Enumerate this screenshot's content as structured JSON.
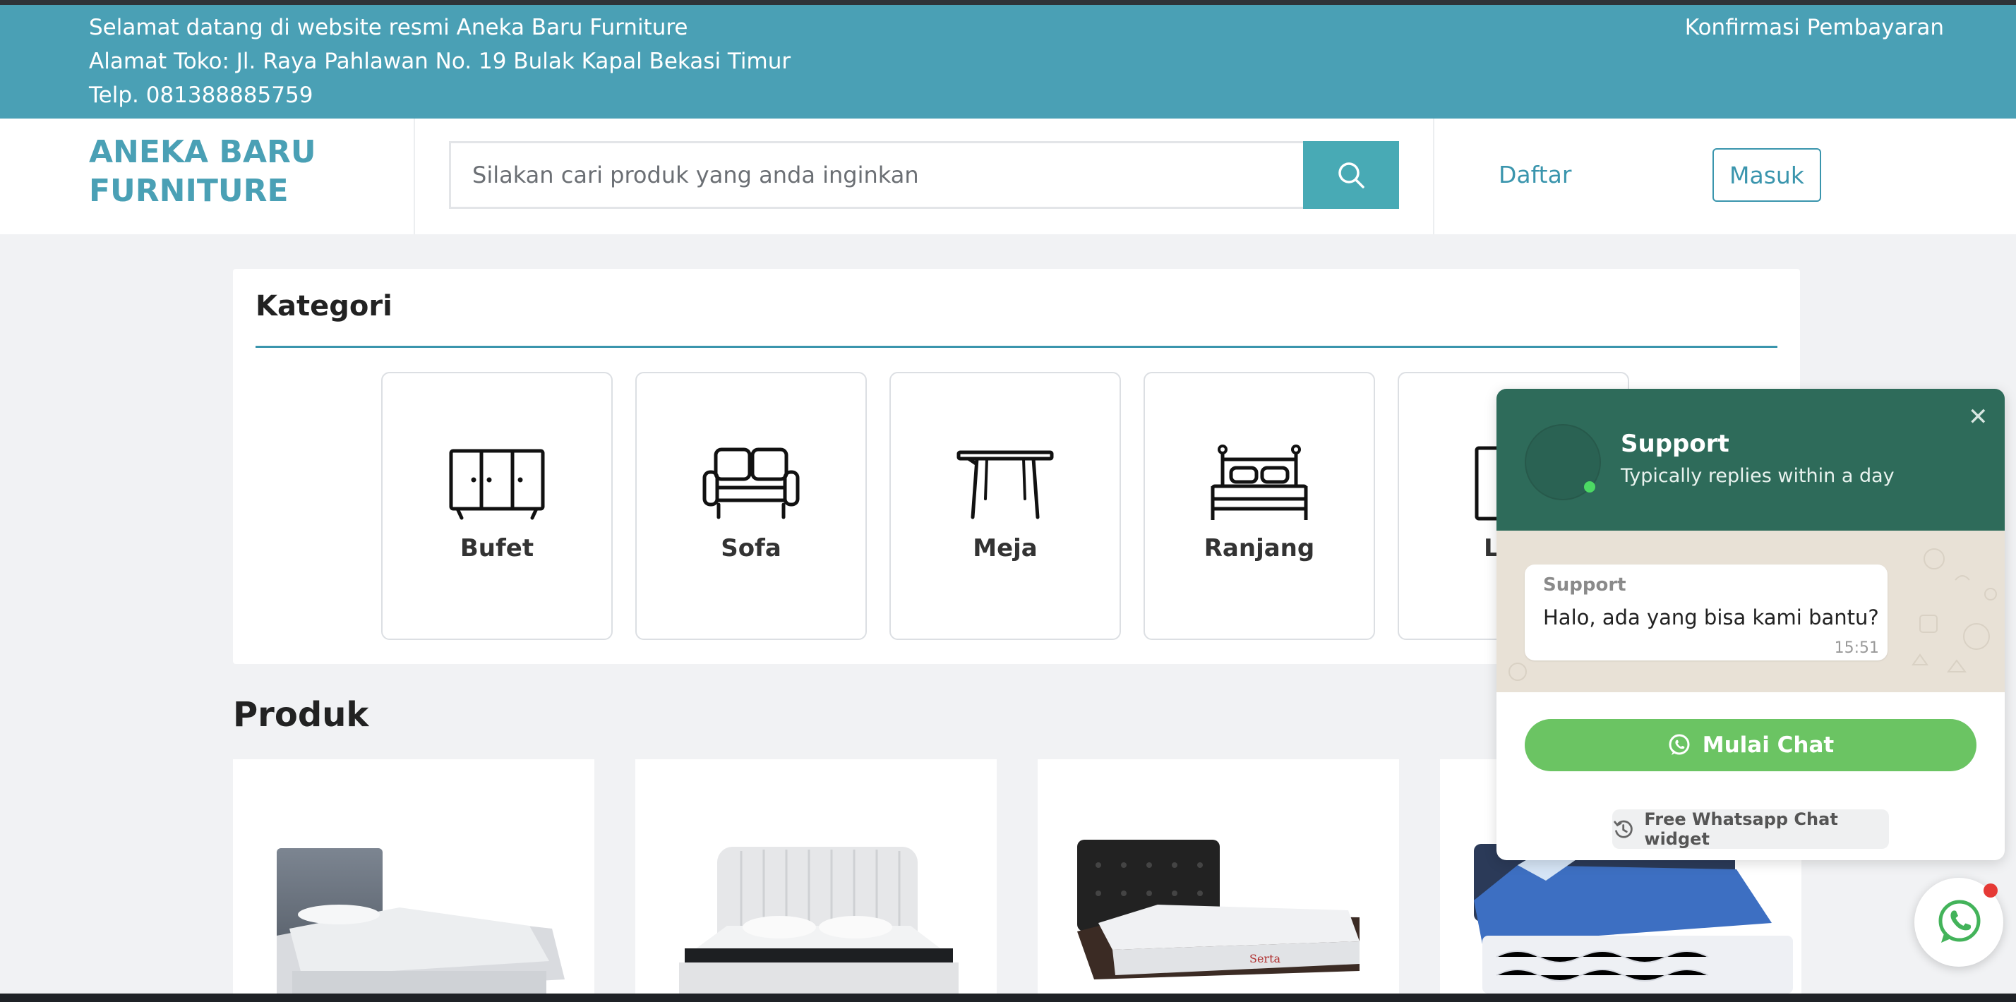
{
  "topbar": {
    "welcome": "Selamat datang di website resmi Aneka Baru Furniture",
    "address": "Alamat Toko: Jl. Raya Pahlawan No. 19 Bulak Kapal Bekasi Timur",
    "phone": "Telp. 081388885759",
    "confirm_link": "Konfirmasi Pembayaran"
  },
  "header": {
    "logo_line1": "ANEKA BARU",
    "logo_line2": "FURNITURE",
    "search_placeholder": "Silakan cari produk yang anda inginkan",
    "search_icon": "search-icon",
    "register_label": "Daftar",
    "login_label": "Masuk"
  },
  "kategori": {
    "title": "Kategori",
    "items": [
      {
        "label": "Bufet",
        "icon": "cabinet-icon"
      },
      {
        "label": "Sofa",
        "icon": "sofa-icon"
      },
      {
        "label": "Meja",
        "icon": "table-icon"
      },
      {
        "label": "Ranjang",
        "icon": "bed-icon"
      },
      {
        "label": "Le",
        "icon": "wardrobe-icon"
      }
    ]
  },
  "produk": {
    "title": "Produk",
    "items": [
      {
        "image": "single-bed-grey-headboard"
      },
      {
        "image": "white-upholstered-bed"
      },
      {
        "image": "black-tufted-bed"
      },
      {
        "image": "blue-trundle-bed"
      }
    ]
  },
  "chat_widget": {
    "name": "Support",
    "status": "Typically replies within a day",
    "message_sender": "Support",
    "message_text": "Halo, ada yang bisa kami bantu?",
    "message_time": "15:51",
    "start_label": "Mulai Chat",
    "footer_label": "Free Whatsapp Chat widget",
    "close_icon": "close-icon"
  },
  "colors": {
    "brand": "#4aa0b5",
    "accent": "#3a95ad",
    "chat_header": "#2e6b5a",
    "chat_button": "#6bc463"
  }
}
